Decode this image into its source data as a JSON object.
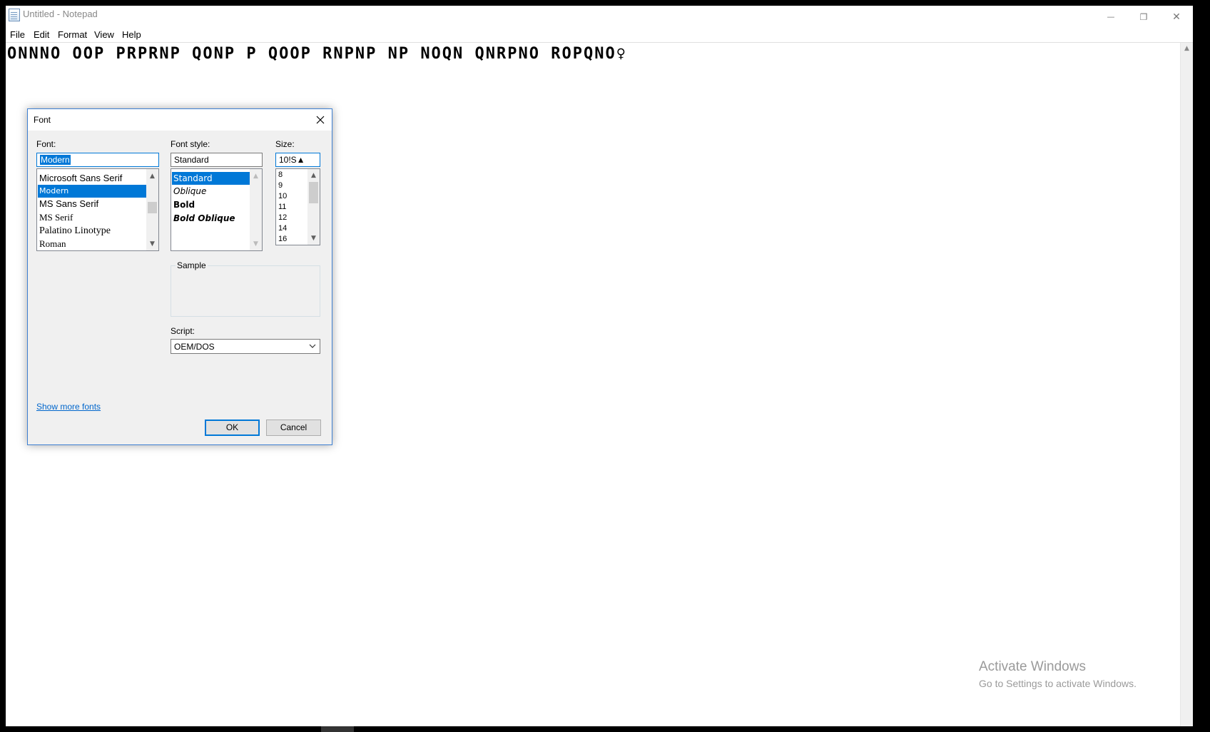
{
  "window": {
    "title": "Untitled - Notepad",
    "minimize_glyph": "—",
    "restore_glyph": "❐",
    "close_glyph": "✕"
  },
  "menu": {
    "items": [
      "File",
      "Edit",
      "Format",
      "View",
      "Help"
    ]
  },
  "editor": {
    "content": "ONNNO OOP PRPRNP QONP P QOOP RNPNP NP NOQN QNRPNO ROPQNO♀"
  },
  "watermark": {
    "line1": "Activate Windows",
    "line2": "Go to Settings to activate Windows."
  },
  "font_dialog": {
    "title": "Font",
    "font_label": "Font:",
    "font_value": "Modern",
    "font_list": [
      "Microsoft Sans Serif",
      "Modern",
      "MS Sans Serif",
      "MS Serif",
      "Palatino Linotype",
      "Roman"
    ],
    "font_selected": "Modern",
    "style_label": "Font style:",
    "style_value": "Standard",
    "style_list": [
      "Standard",
      "Oblique",
      "Bold",
      "Bold Oblique"
    ],
    "style_selected": "Standard",
    "size_label": "Size:",
    "size_value": "10!S▲",
    "size_list": [
      "8",
      "9",
      "10",
      "11",
      "12",
      "14",
      "16"
    ],
    "sample_label": "Sample",
    "script_label": "Script:",
    "script_value": "OEM/DOS",
    "show_more_fonts": "Show more fonts",
    "ok_label": "OK",
    "cancel_label": "Cancel"
  },
  "colors": {
    "accent": "#0078d7",
    "link": "#0066cc",
    "dialog_bg": "#f0f0f0"
  }
}
